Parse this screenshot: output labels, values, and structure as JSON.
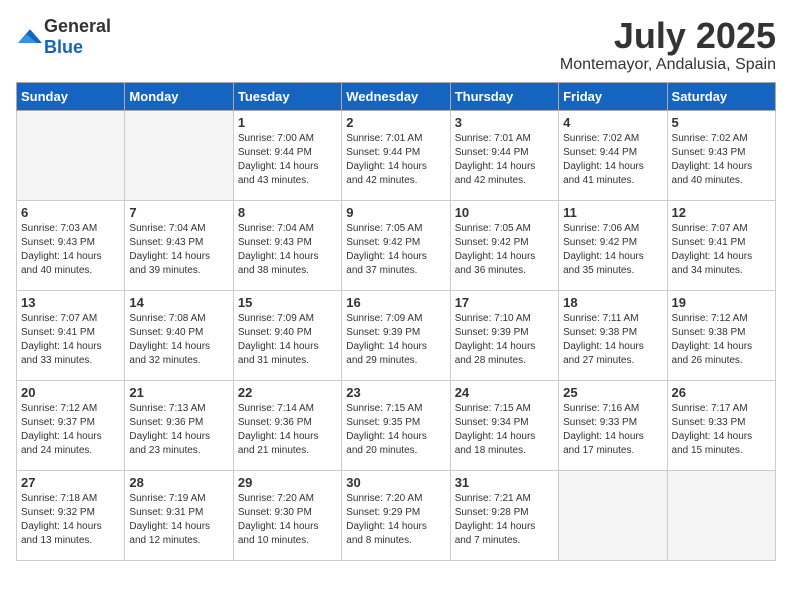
{
  "logo": {
    "general": "General",
    "blue": "Blue"
  },
  "title": "July 2025",
  "location": "Montemayor, Andalusia, Spain",
  "headers": [
    "Sunday",
    "Monday",
    "Tuesday",
    "Wednesday",
    "Thursday",
    "Friday",
    "Saturday"
  ],
  "weeks": [
    [
      {
        "day": "",
        "info": "",
        "empty": true
      },
      {
        "day": "",
        "info": "",
        "empty": true
      },
      {
        "day": "1",
        "info": "Sunrise: 7:00 AM\nSunset: 9:44 PM\nDaylight: 14 hours\nand 43 minutes.",
        "empty": false
      },
      {
        "day": "2",
        "info": "Sunrise: 7:01 AM\nSunset: 9:44 PM\nDaylight: 14 hours\nand 42 minutes.",
        "empty": false
      },
      {
        "day": "3",
        "info": "Sunrise: 7:01 AM\nSunset: 9:44 PM\nDaylight: 14 hours\nand 42 minutes.",
        "empty": false
      },
      {
        "day": "4",
        "info": "Sunrise: 7:02 AM\nSunset: 9:44 PM\nDaylight: 14 hours\nand 41 minutes.",
        "empty": false
      },
      {
        "day": "5",
        "info": "Sunrise: 7:02 AM\nSunset: 9:43 PM\nDaylight: 14 hours\nand 40 minutes.",
        "empty": false
      }
    ],
    [
      {
        "day": "6",
        "info": "Sunrise: 7:03 AM\nSunset: 9:43 PM\nDaylight: 14 hours\nand 40 minutes.",
        "empty": false
      },
      {
        "day": "7",
        "info": "Sunrise: 7:04 AM\nSunset: 9:43 PM\nDaylight: 14 hours\nand 39 minutes.",
        "empty": false
      },
      {
        "day": "8",
        "info": "Sunrise: 7:04 AM\nSunset: 9:43 PM\nDaylight: 14 hours\nand 38 minutes.",
        "empty": false
      },
      {
        "day": "9",
        "info": "Sunrise: 7:05 AM\nSunset: 9:42 PM\nDaylight: 14 hours\nand 37 minutes.",
        "empty": false
      },
      {
        "day": "10",
        "info": "Sunrise: 7:05 AM\nSunset: 9:42 PM\nDaylight: 14 hours\nand 36 minutes.",
        "empty": false
      },
      {
        "day": "11",
        "info": "Sunrise: 7:06 AM\nSunset: 9:42 PM\nDaylight: 14 hours\nand 35 minutes.",
        "empty": false
      },
      {
        "day": "12",
        "info": "Sunrise: 7:07 AM\nSunset: 9:41 PM\nDaylight: 14 hours\nand 34 minutes.",
        "empty": false
      }
    ],
    [
      {
        "day": "13",
        "info": "Sunrise: 7:07 AM\nSunset: 9:41 PM\nDaylight: 14 hours\nand 33 minutes.",
        "empty": false
      },
      {
        "day": "14",
        "info": "Sunrise: 7:08 AM\nSunset: 9:40 PM\nDaylight: 14 hours\nand 32 minutes.",
        "empty": false
      },
      {
        "day": "15",
        "info": "Sunrise: 7:09 AM\nSunset: 9:40 PM\nDaylight: 14 hours\nand 31 minutes.",
        "empty": false
      },
      {
        "day": "16",
        "info": "Sunrise: 7:09 AM\nSunset: 9:39 PM\nDaylight: 14 hours\nand 29 minutes.",
        "empty": false
      },
      {
        "day": "17",
        "info": "Sunrise: 7:10 AM\nSunset: 9:39 PM\nDaylight: 14 hours\nand 28 minutes.",
        "empty": false
      },
      {
        "day": "18",
        "info": "Sunrise: 7:11 AM\nSunset: 9:38 PM\nDaylight: 14 hours\nand 27 minutes.",
        "empty": false
      },
      {
        "day": "19",
        "info": "Sunrise: 7:12 AM\nSunset: 9:38 PM\nDaylight: 14 hours\nand 26 minutes.",
        "empty": false
      }
    ],
    [
      {
        "day": "20",
        "info": "Sunrise: 7:12 AM\nSunset: 9:37 PM\nDaylight: 14 hours\nand 24 minutes.",
        "empty": false
      },
      {
        "day": "21",
        "info": "Sunrise: 7:13 AM\nSunset: 9:36 PM\nDaylight: 14 hours\nand 23 minutes.",
        "empty": false
      },
      {
        "day": "22",
        "info": "Sunrise: 7:14 AM\nSunset: 9:36 PM\nDaylight: 14 hours\nand 21 minutes.",
        "empty": false
      },
      {
        "day": "23",
        "info": "Sunrise: 7:15 AM\nSunset: 9:35 PM\nDaylight: 14 hours\nand 20 minutes.",
        "empty": false
      },
      {
        "day": "24",
        "info": "Sunrise: 7:15 AM\nSunset: 9:34 PM\nDaylight: 14 hours\nand 18 minutes.",
        "empty": false
      },
      {
        "day": "25",
        "info": "Sunrise: 7:16 AM\nSunset: 9:33 PM\nDaylight: 14 hours\nand 17 minutes.",
        "empty": false
      },
      {
        "day": "26",
        "info": "Sunrise: 7:17 AM\nSunset: 9:33 PM\nDaylight: 14 hours\nand 15 minutes.",
        "empty": false
      }
    ],
    [
      {
        "day": "27",
        "info": "Sunrise: 7:18 AM\nSunset: 9:32 PM\nDaylight: 14 hours\nand 13 minutes.",
        "empty": false
      },
      {
        "day": "28",
        "info": "Sunrise: 7:19 AM\nSunset: 9:31 PM\nDaylight: 14 hours\nand 12 minutes.",
        "empty": false
      },
      {
        "day": "29",
        "info": "Sunrise: 7:20 AM\nSunset: 9:30 PM\nDaylight: 14 hours\nand 10 minutes.",
        "empty": false
      },
      {
        "day": "30",
        "info": "Sunrise: 7:20 AM\nSunset: 9:29 PM\nDaylight: 14 hours\nand 8 minutes.",
        "empty": false
      },
      {
        "day": "31",
        "info": "Sunrise: 7:21 AM\nSunset: 9:28 PM\nDaylight: 14 hours\nand 7 minutes.",
        "empty": false
      },
      {
        "day": "",
        "info": "",
        "empty": true,
        "shaded": true
      },
      {
        "day": "",
        "info": "",
        "empty": true,
        "shaded": true
      }
    ]
  ]
}
